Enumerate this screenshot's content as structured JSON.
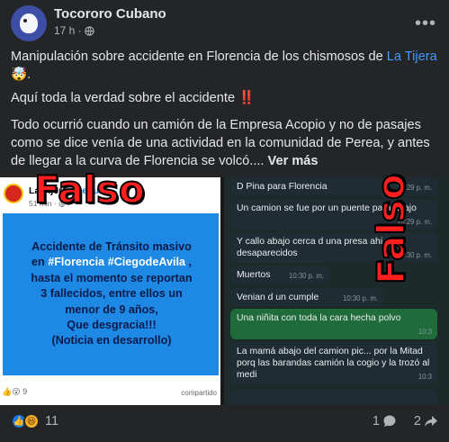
{
  "post": {
    "author": "Tocororo Cubano",
    "time": "17 h ·",
    "text1_pre": "Manipulación sobre accidente en Florencia de los chismosos de ",
    "text1_link": "La Tijera",
    "text1_emoji": "🤯",
    "text1_end": ".",
    "text2": "Aquí toda la verdad sobre el accidente",
    "text2_emoji": "‼️",
    "text3": "Todo ocurrió cuando un camión de la Empresa Acopio y no de pasajes como se dice venía de una actividad en la comunidad de Perea, y antes de llegar a la curva de Florencia se volcó....",
    "see_more": "Ver más"
  },
  "left_screenshot": {
    "page_name": "La Tijera",
    "dot": " · ",
    "follow": "Seguir",
    "time": "51 min · ",
    "line1": "Accidente de Tránsito masivo",
    "line2_pre": "en ",
    "hashtag1": "#Florencia",
    "hashtag2": "#CiegodeAvila",
    "line2_post": " ,",
    "line3": "hasta el momento se reportan",
    "line4": "3 fallecidos, entre ellos un",
    "line5": "menor de 9 años,",
    "line6": "Que desgracia!!!",
    "line7": "(Noticia en desarrollo)",
    "reactions": "👍😮 9",
    "shares": "compartido",
    "stamp": "Falso"
  },
  "chat": {
    "messages": [
      {
        "text": "D Pina para Florencia",
        "time": "10:29 p. m."
      },
      {
        "text": "Un camion se fue por un puente para abajo",
        "time": "10:29 p. m."
      },
      {
        "text": "Y callo abajo cerca d una presa ahi desaparecidos",
        "time": "10:30 p. m."
      },
      {
        "text": "Muertos",
        "time": "10:30 p. m."
      },
      {
        "text": "Venian d un cumple",
        "time": "10:30 p. m."
      },
      {
        "text": "Una niñita con toda la cara hecha polvo",
        "time": "10:3"
      },
      {
        "text": "La mamá abajo del camion pic... por la Mitad porq las barandas camión la cogio y la trozó al medi",
        "time": "10:3"
      },
      {
        "text": "",
        "time": ""
      }
    ],
    "stamp": "Falso"
  },
  "footer": {
    "reaction_count": "11",
    "comments": "1",
    "shares": "2"
  },
  "colors": {
    "background": "#242526",
    "link": "#4599ff",
    "like_blue": "#1877f2",
    "haha_yellow": "#f7b125",
    "falso_red": "#ff1f1f",
    "fake_news_blue": "#1e88e5"
  }
}
